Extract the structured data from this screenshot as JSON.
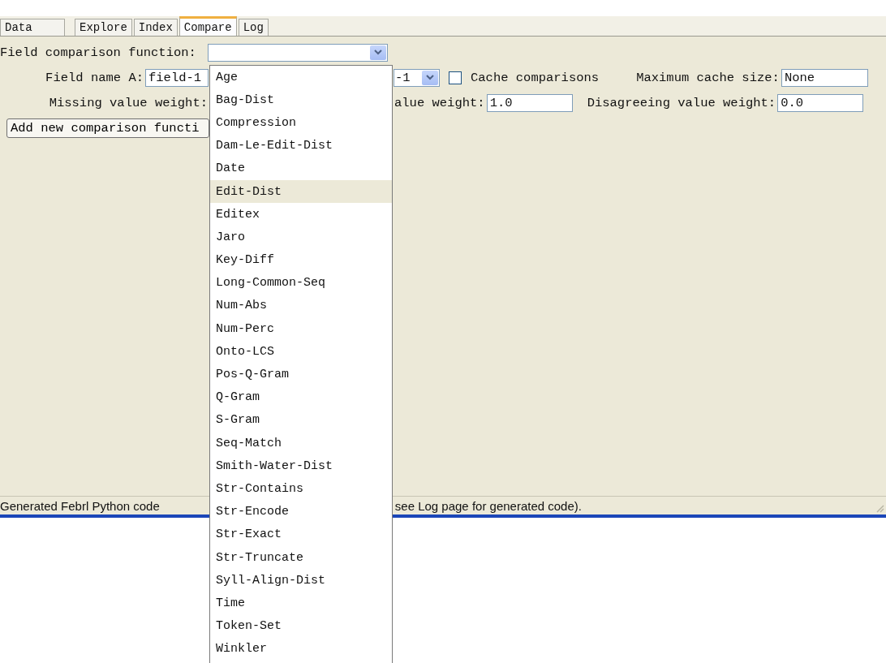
{
  "tabs": [
    {
      "label": "Data",
      "selected": false
    },
    {
      "label": "Explore",
      "selected": false
    },
    {
      "label": "Index",
      "selected": false
    },
    {
      "label": "Compare",
      "selected": true
    },
    {
      "label": "Log",
      "selected": false
    }
  ],
  "compare": {
    "function_label": "Field comparison function:",
    "field_a_label": "Field name A:",
    "field_a_value": "field-1",
    "field_b_value": "-1",
    "cache_checked": false,
    "cache_label": "Cache comparisons",
    "max_cache_label": "Maximum cache size:",
    "max_cache_value": "None",
    "missing_label": "Missing value weight:",
    "agree_label": "alue weight:",
    "agree_value": "1.0",
    "disagree_label": "Disagreeing value weight:",
    "disagree_value": "0.0",
    "add_button": "Add new comparison functi"
  },
  "dropdown_items": [
    {
      "label": "Age",
      "selected": false
    },
    {
      "label": "Bag-Dist",
      "selected": false
    },
    {
      "label": "Compression",
      "selected": false
    },
    {
      "label": "Dam-Le-Edit-Dist",
      "selected": false
    },
    {
      "label": "Date",
      "selected": false
    },
    {
      "label": "Edit-Dist",
      "selected": true
    },
    {
      "label": "Editex",
      "selected": false
    },
    {
      "label": "Jaro",
      "selected": false
    },
    {
      "label": "Key-Diff",
      "selected": false
    },
    {
      "label": "Long-Common-Seq",
      "selected": false
    },
    {
      "label": "Num-Abs",
      "selected": false
    },
    {
      "label": "Num-Perc",
      "selected": false
    },
    {
      "label": "Onto-LCS",
      "selected": false
    },
    {
      "label": "Pos-Q-Gram",
      "selected": false
    },
    {
      "label": "Q-Gram",
      "selected": false
    },
    {
      "label": "S-Gram",
      "selected": false
    },
    {
      "label": "Seq-Match",
      "selected": false
    },
    {
      "label": "Smith-Water-Dist",
      "selected": false
    },
    {
      "label": "Str-Contains",
      "selected": false
    },
    {
      "label": "Str-Encode",
      "selected": false
    },
    {
      "label": "Str-Exact",
      "selected": false
    },
    {
      "label": "Str-Truncate",
      "selected": false
    },
    {
      "label": "Syll-Align-Dist",
      "selected": false
    },
    {
      "label": "Time",
      "selected": false
    },
    {
      "label": "Token-Set",
      "selected": false
    },
    {
      "label": "Winkler",
      "selected": false
    }
  ],
  "status_bar": {
    "left": "Generated Febrl Python code",
    "right": "see Log page for generated code)."
  }
}
